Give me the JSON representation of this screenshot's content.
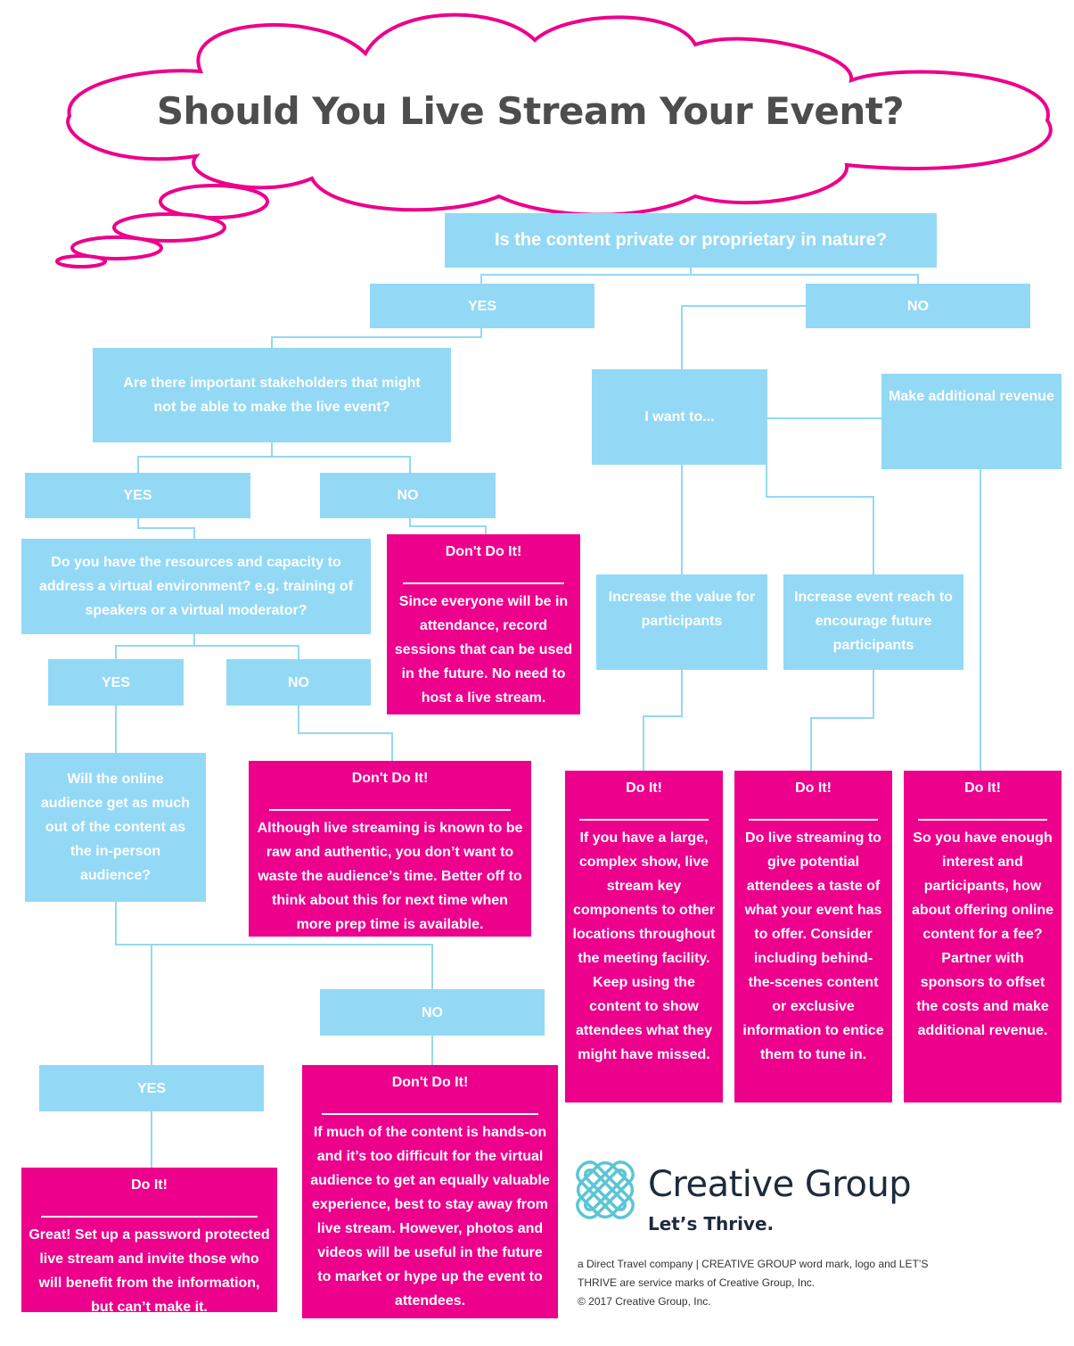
{
  "title": "Should You Live Stream Your Event?",
  "colors": {
    "question": "#93d9f5",
    "outcome": "#ec008c",
    "cloud_stroke": "#ec008c",
    "title_text": "#4d4d4d",
    "brand_text": "#1e2b3c",
    "logo": "#5bc5d3"
  },
  "nodes": {
    "q_private": "Is the content private or proprietary in nature?",
    "a_private_yes": "YES",
    "a_private_no": "NO",
    "q_stakeholders": "Are there important stakeholders that might not be able to make the live event?",
    "a_stake_yes": "YES",
    "a_stake_no": "NO",
    "q_resources": "Do you have the resources and capacity to address a virtual environment? e.g. training of speakers or a virtual moderator?",
    "a_res_yes": "YES",
    "a_res_no": "NO",
    "q_online": "Will the online audience get as much out of the content as the in-person audience?",
    "a_online_yes": "YES",
    "a_online_no": "NO",
    "q_want": "I want to...",
    "opt_revenue": "Make additional revenue",
    "opt_value": "Increase the value for participants",
    "opt_reach": "Increase event reach to encourage future participants"
  },
  "outcomes": {
    "stake_no": {
      "head": "Don't Do It!",
      "body": "Since everyone will be in attendance, record sessions that can be used in the future. No need to host a live stream."
    },
    "res_no": {
      "head": "Don't Do It!",
      "body": "Although live streaming is known to be raw and authentic, you don’t want to waste the audience’s time. Better off to think about this for next time when more prep time is available."
    },
    "online_yes": {
      "head": "Do It!",
      "body": "Great! Set up a password protected live stream and invite those who will benefit from the information, but can’t make it."
    },
    "online_no": {
      "head": "Don't Do It!",
      "body": "If much of the content is hands-on and it’s too difficult for the virtual audience to get an equally valuable experience, best to stay away from live stream. However, photos and videos will be useful in the future to market or hype up the event to attendees."
    },
    "value": {
      "head": "Do It!",
      "body": "If you have a large, complex show, live stream key components to other locations throughout the meeting facility. Keep using the content to show attendees what they might have missed."
    },
    "reach": {
      "head": "Do It!",
      "body": "Do live streaming to give potential attendees a taste of what your event has to offer. Consider including behind-the-scenes content or exclusive information to entice them to tune in."
    },
    "revenue": {
      "head": "Do It!",
      "body": "So you have enough interest and participants, how about offering online content for a fee? Partner with sponsors to offset the costs and make additional revenue."
    }
  },
  "brand": {
    "name": "Creative Group",
    "tagline": "Let’s Thrive.",
    "legal_line1": "a Direct Travel company  | CREATIVE GROUP word mark, logo and LET’S",
    "legal_line2": "THRIVE are service marks of Creative Group, Inc.",
    "copyright": "© 2017 Creative Group, Inc."
  }
}
